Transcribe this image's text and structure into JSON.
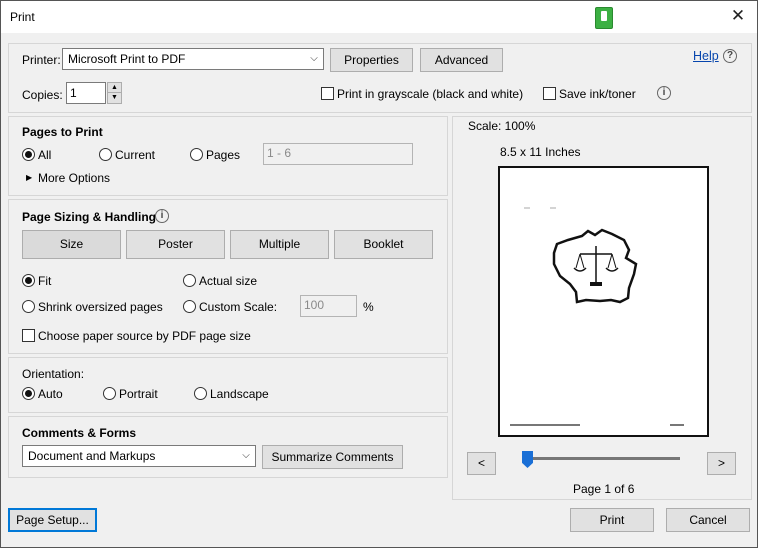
{
  "window": {
    "title": "Print",
    "close_label": "✕"
  },
  "printer": {
    "label": "Printer:",
    "selected": "Microsoft Print to PDF",
    "properties": "Properties",
    "advanced": "Advanced",
    "help": "Help"
  },
  "copies": {
    "label": "Copies:",
    "value": "1"
  },
  "options": {
    "grayscale": "Print in grayscale (black and white)",
    "save_ink": "Save ink/toner"
  },
  "pages_to_print": {
    "title": "Pages to Print",
    "all": "All",
    "current": "Current",
    "pages": "Pages",
    "range_placeholder": "1 - 6",
    "more_options": "More Options"
  },
  "sizing": {
    "title": "Page Sizing & Handling",
    "size": "Size",
    "poster": "Poster",
    "multiple": "Multiple",
    "booklet": "Booklet",
    "fit": "Fit",
    "actual_size": "Actual size",
    "shrink": "Shrink oversized pages",
    "custom_scale": "Custom Scale:",
    "custom_scale_value": "100",
    "percent": "%",
    "choose_paper": "Choose paper source by PDF page size"
  },
  "orientation": {
    "title": "Orientation:",
    "auto": "Auto",
    "portrait": "Portrait",
    "landscape": "Landscape"
  },
  "comments": {
    "title": "Comments & Forms",
    "selected": "Document and Markups",
    "summarize": "Summarize Comments"
  },
  "preview": {
    "scale": "Scale: 100%",
    "paper_size": "8.5 x 11 Inches",
    "page_indicator": "Page 1 of 6",
    "prev": "<",
    "next": ">",
    "slider_fraction": 0.0
  },
  "footer": {
    "page_setup": "Page Setup...",
    "print": "Print",
    "cancel": "Cancel"
  },
  "icons": {
    "info": "i",
    "dropdown": "⌵",
    "more_options_arrow": "▶"
  }
}
